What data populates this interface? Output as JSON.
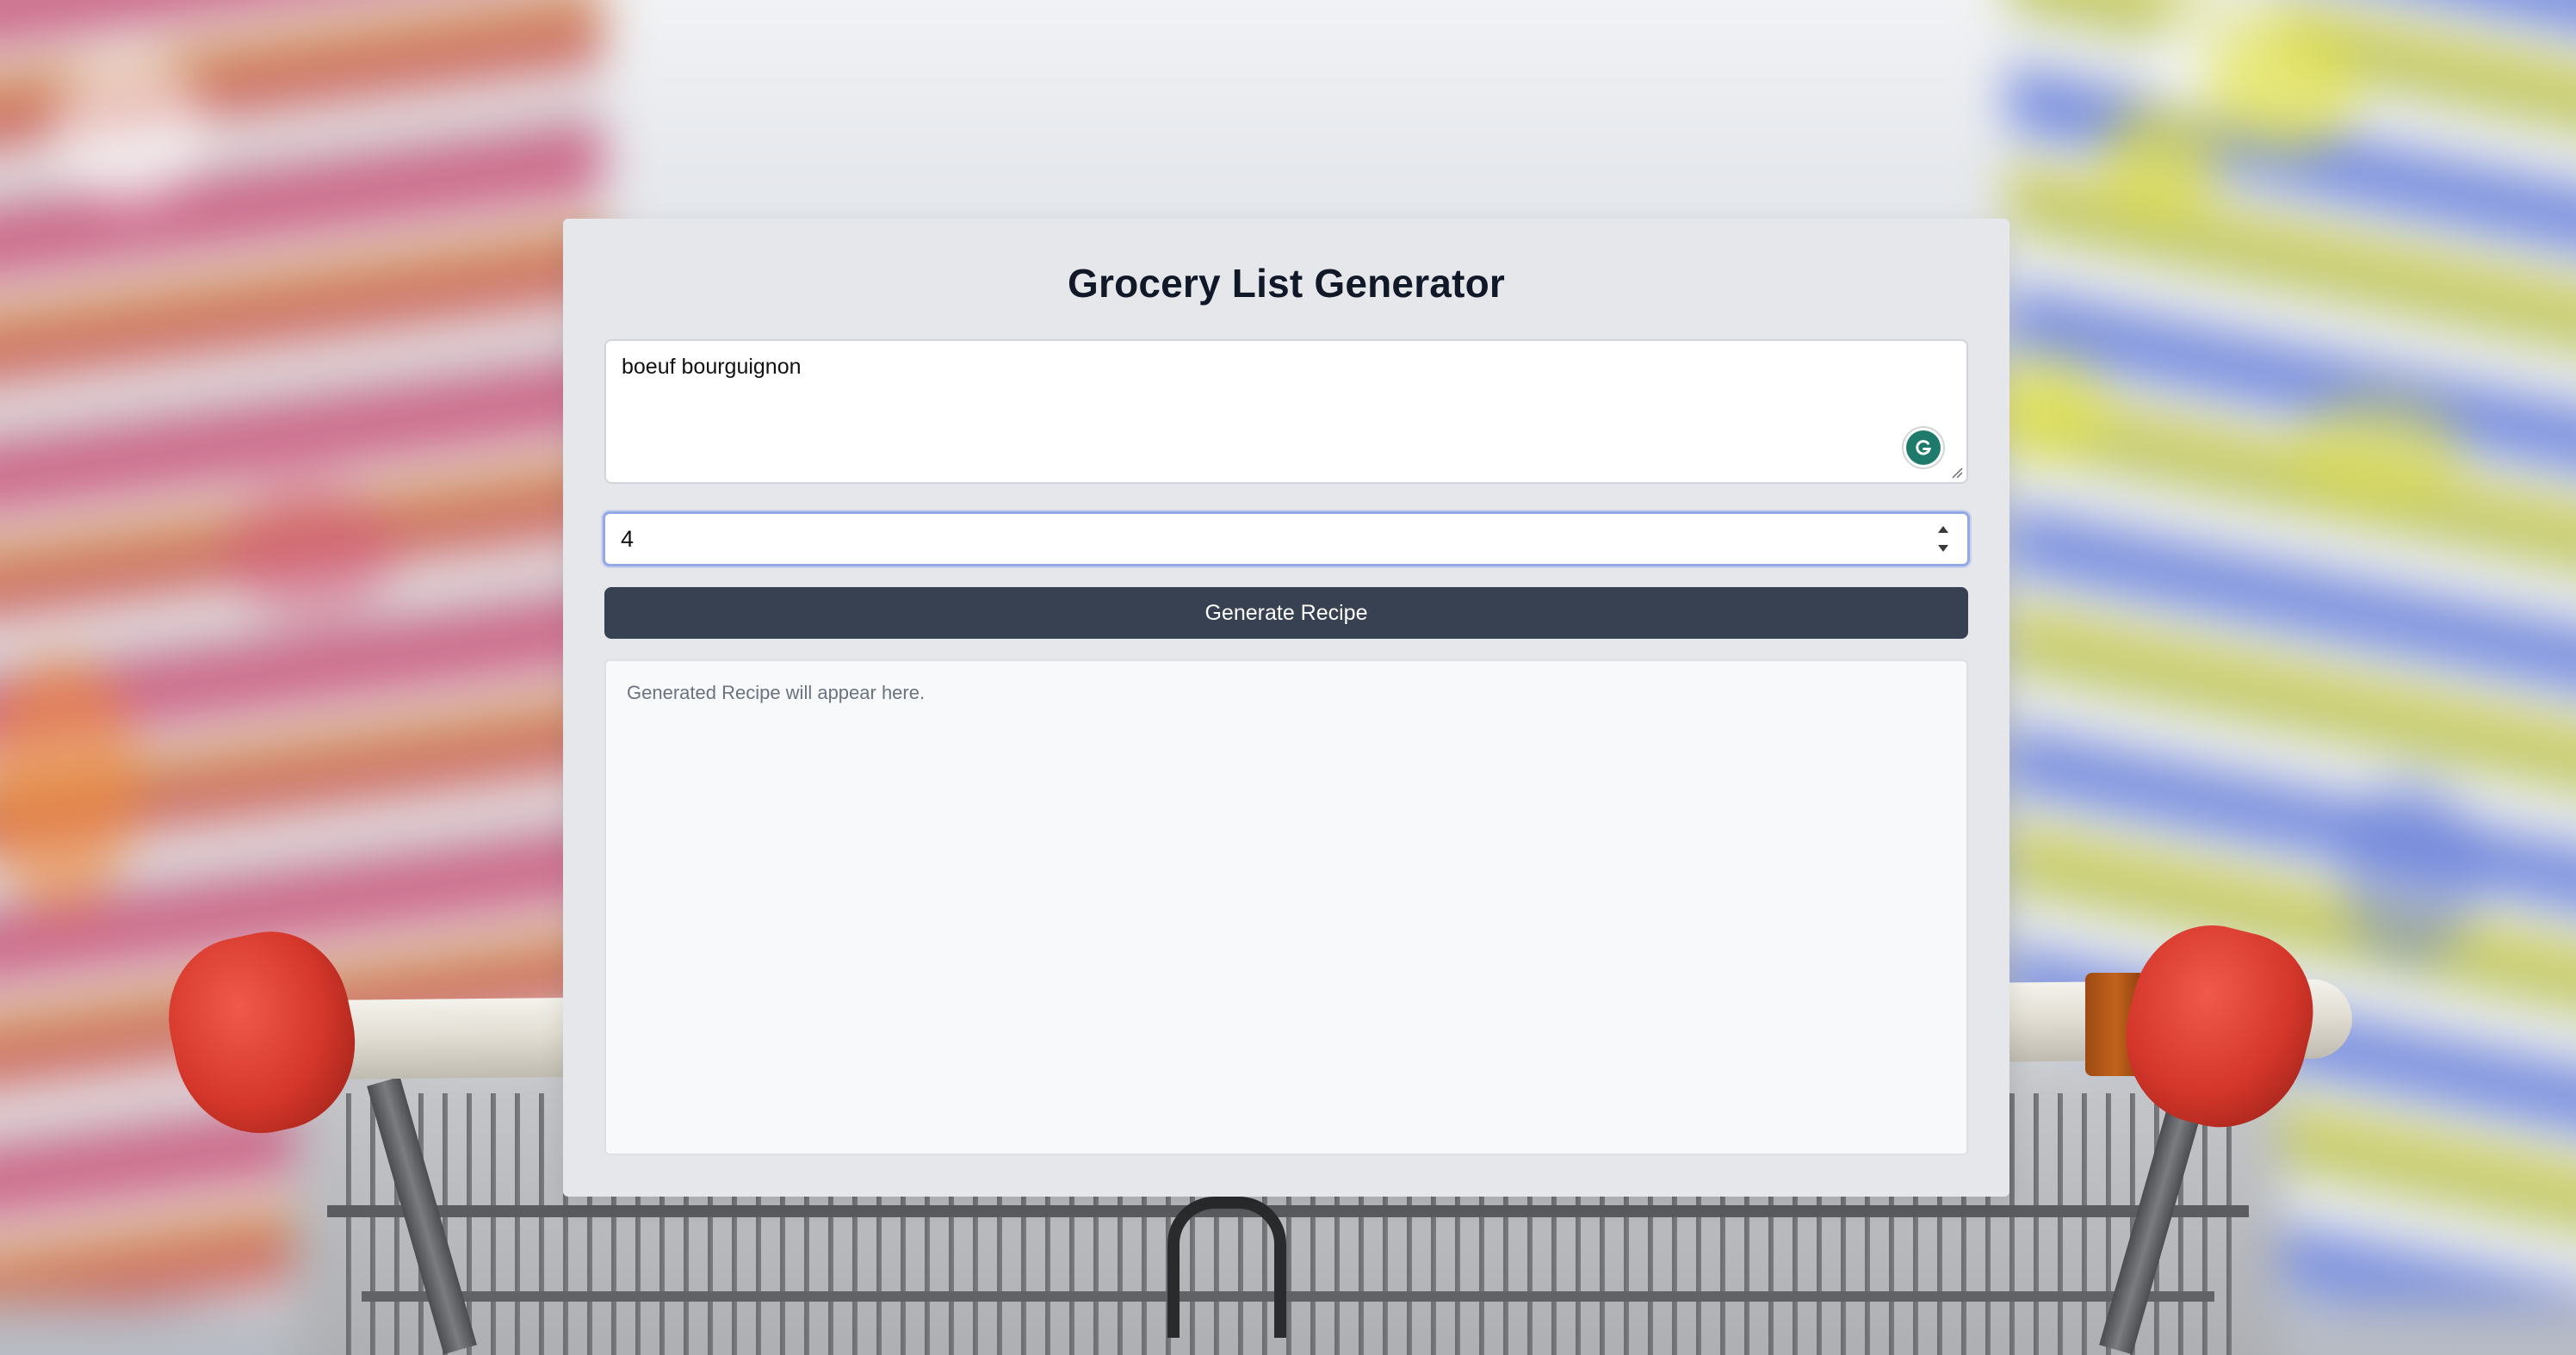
{
  "app": {
    "title": "Grocery List Generator"
  },
  "form": {
    "recipe_input": {
      "value": "boeuf bourguignon"
    },
    "servings_input": {
      "value": "4"
    },
    "generate_button_label": "Generate Recipe"
  },
  "output": {
    "placeholder": "Generated Recipe will appear here."
  },
  "colors": {
    "card_background": "#e5e7eb",
    "button_background": "#374151",
    "focus_border": "#93a8e6",
    "grammarly": "#1e7a6a"
  },
  "icons": {
    "grammarly": "grammarly-icon",
    "resize": "resize-handle-icon",
    "spin_up": "chevron-up-icon",
    "spin_down": "chevron-down-icon"
  }
}
